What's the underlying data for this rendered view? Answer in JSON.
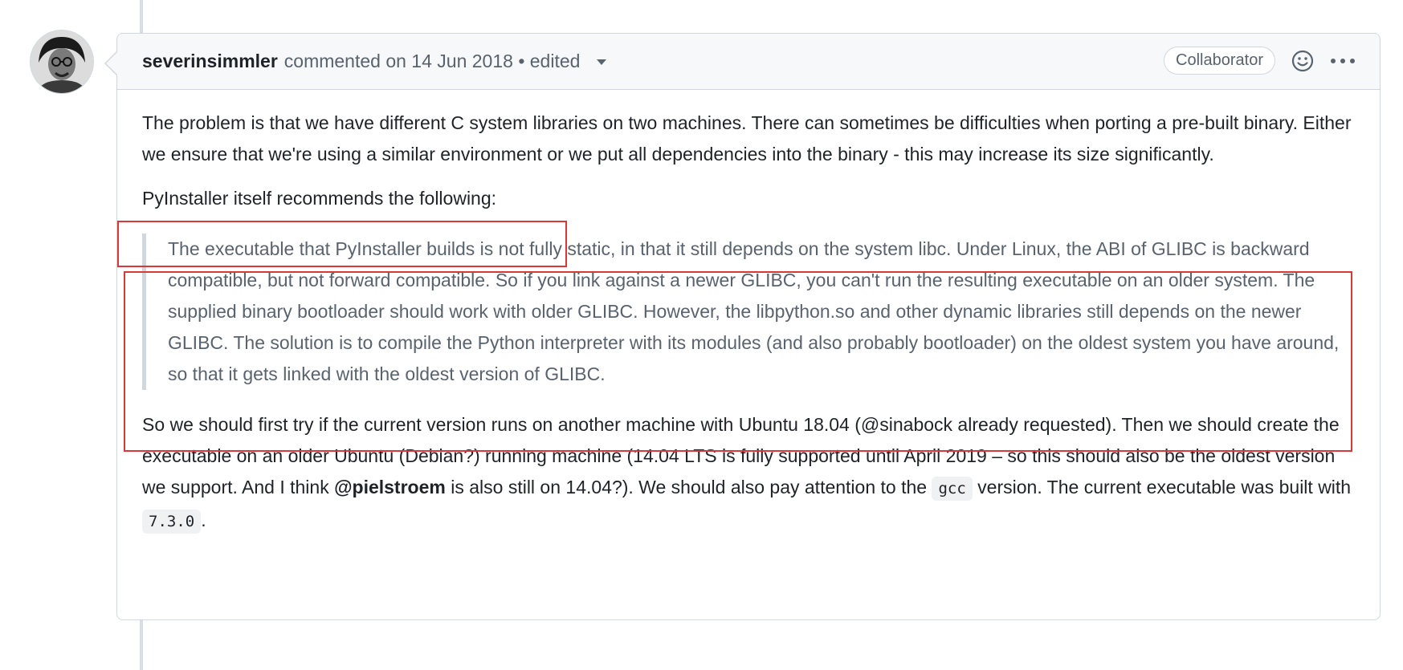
{
  "comment": {
    "author": "severinsimmler",
    "meta": "commented on 14 Jun 2018 • edited",
    "badge": "Collaborator",
    "paragraphs": {
      "p1": "The problem is that we have different C system libraries on two machines. There can sometimes be difficulties when porting a pre-built binary. Either we ensure that we're using a similar environment or we put all dependencies into the binary - this may increase its size significantly.",
      "p2": "PyInstaller itself recommends the following:",
      "quote": "The executable that PyInstaller builds is not fully static, in that it still depends on the system libc. Under Linux, the ABI of GLIBC is backward compatible, but not forward compatible. So if you link against a newer GLIBC, you can't run the resulting executable on an older system. The supplied binary bootloader should work with older GLIBC. However, the libpython.so and other dynamic libraries still depends on the newer GLIBC. The solution is to compile the Python interpreter with its modules (and also probably bootloader) on the oldest system you have around, so that it gets linked with the oldest version of GLIBC.",
      "p3_part1": "So we should first try if the current version runs on another machine with Ubuntu 18.04 (@sinabock already requested). Then we should create the executable on an older Ubuntu (Debian?) running machine (14.04 LTS is fully supported until April 2019 – so this should also be the oldest version we support. And I think ",
      "p3_mention": "@pielstroem",
      "p3_part2": " is also still on 14.04?). We should also pay attention to the ",
      "p3_code1": "gcc",
      "p3_part3": " version. The current executable was built with ",
      "p3_code2": "7.3.0",
      "p3_part4": "."
    }
  },
  "icons": {
    "avatar": "user-avatar",
    "reaction": "smiley-icon",
    "more": "kebab-icon",
    "caret": "caret-down-icon"
  },
  "colors": {
    "highlight": "#d9383a",
    "border": "#d0d7de",
    "header_bg": "#f6f8fa",
    "muted_text": "#59636e"
  }
}
